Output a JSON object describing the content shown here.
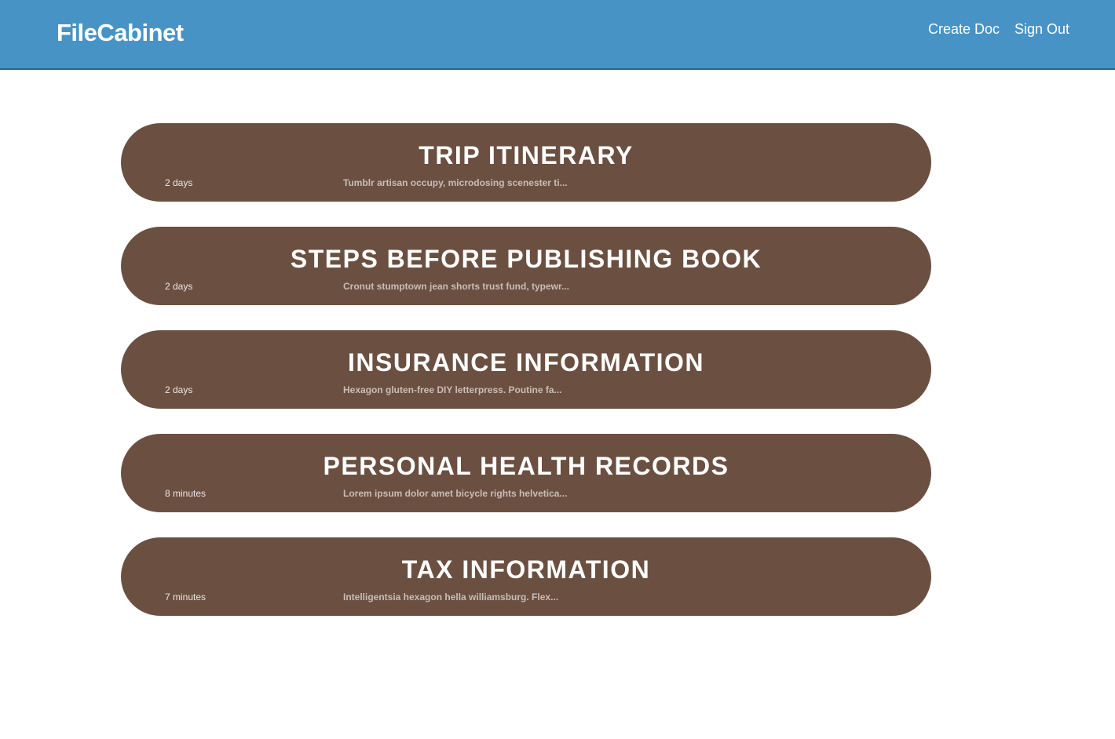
{
  "header": {
    "brand": "FileCabinet",
    "nav": {
      "create_doc": "Create Doc",
      "sign_out": "Sign Out"
    }
  },
  "colors": {
    "navbar": "#4793c6",
    "card": "#6b5042"
  },
  "documents": [
    {
      "title": "TRIP ITINERARY",
      "age": "2 days",
      "snippet": "Tumblr artisan occupy, microdosing scenester ti..."
    },
    {
      "title": "STEPS BEFORE PUBLISHING BOOK",
      "age": "2 days",
      "snippet": "Cronut stumptown jean shorts trust fund, typewr..."
    },
    {
      "title": "INSURANCE INFORMATION",
      "age": "2 days",
      "snippet": "Hexagon gluten-free DIY letterpress. Poutine fa..."
    },
    {
      "title": "PERSONAL HEALTH RECORDS",
      "age": "8 minutes",
      "snippet": "Lorem ipsum dolor amet bicycle rights helvetica..."
    },
    {
      "title": "TAX INFORMATION",
      "age": "7 minutes",
      "snippet": "Intelligentsia hexagon hella williamsburg. Flex..."
    }
  ]
}
